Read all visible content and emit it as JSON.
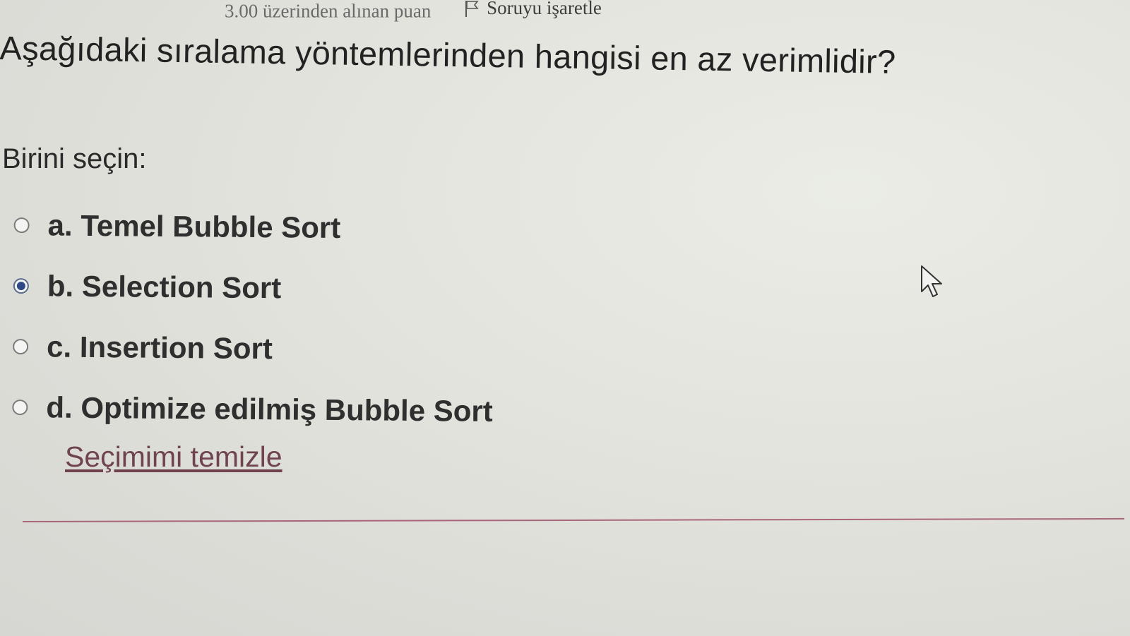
{
  "header": {
    "points_text": "3.00 üzerinden alınan puan",
    "flag_label": "Soruyu işaretle",
    "flag_icon": "flag-icon"
  },
  "question": {
    "text": "Aşağıdaki sıralama yöntemlerinden hangisi en az verimlidir?",
    "prompt": "Birini seçin:"
  },
  "options": [
    {
      "label": "a. Temel Bubble Sort",
      "selected": false
    },
    {
      "label": "b. Selection Sort",
      "selected": true
    },
    {
      "label": "c. Insertion Sort",
      "selected": false
    },
    {
      "label": "d. Optimize edilmiş Bubble Sort",
      "selected": false
    }
  ],
  "clear_selection_label": "Seçimimi temizle",
  "colors": {
    "radio_selected": "#2d4a87",
    "link": "#6f4350",
    "divider": "#a0506a"
  },
  "cursor_icon": "mouse-pointer-icon"
}
